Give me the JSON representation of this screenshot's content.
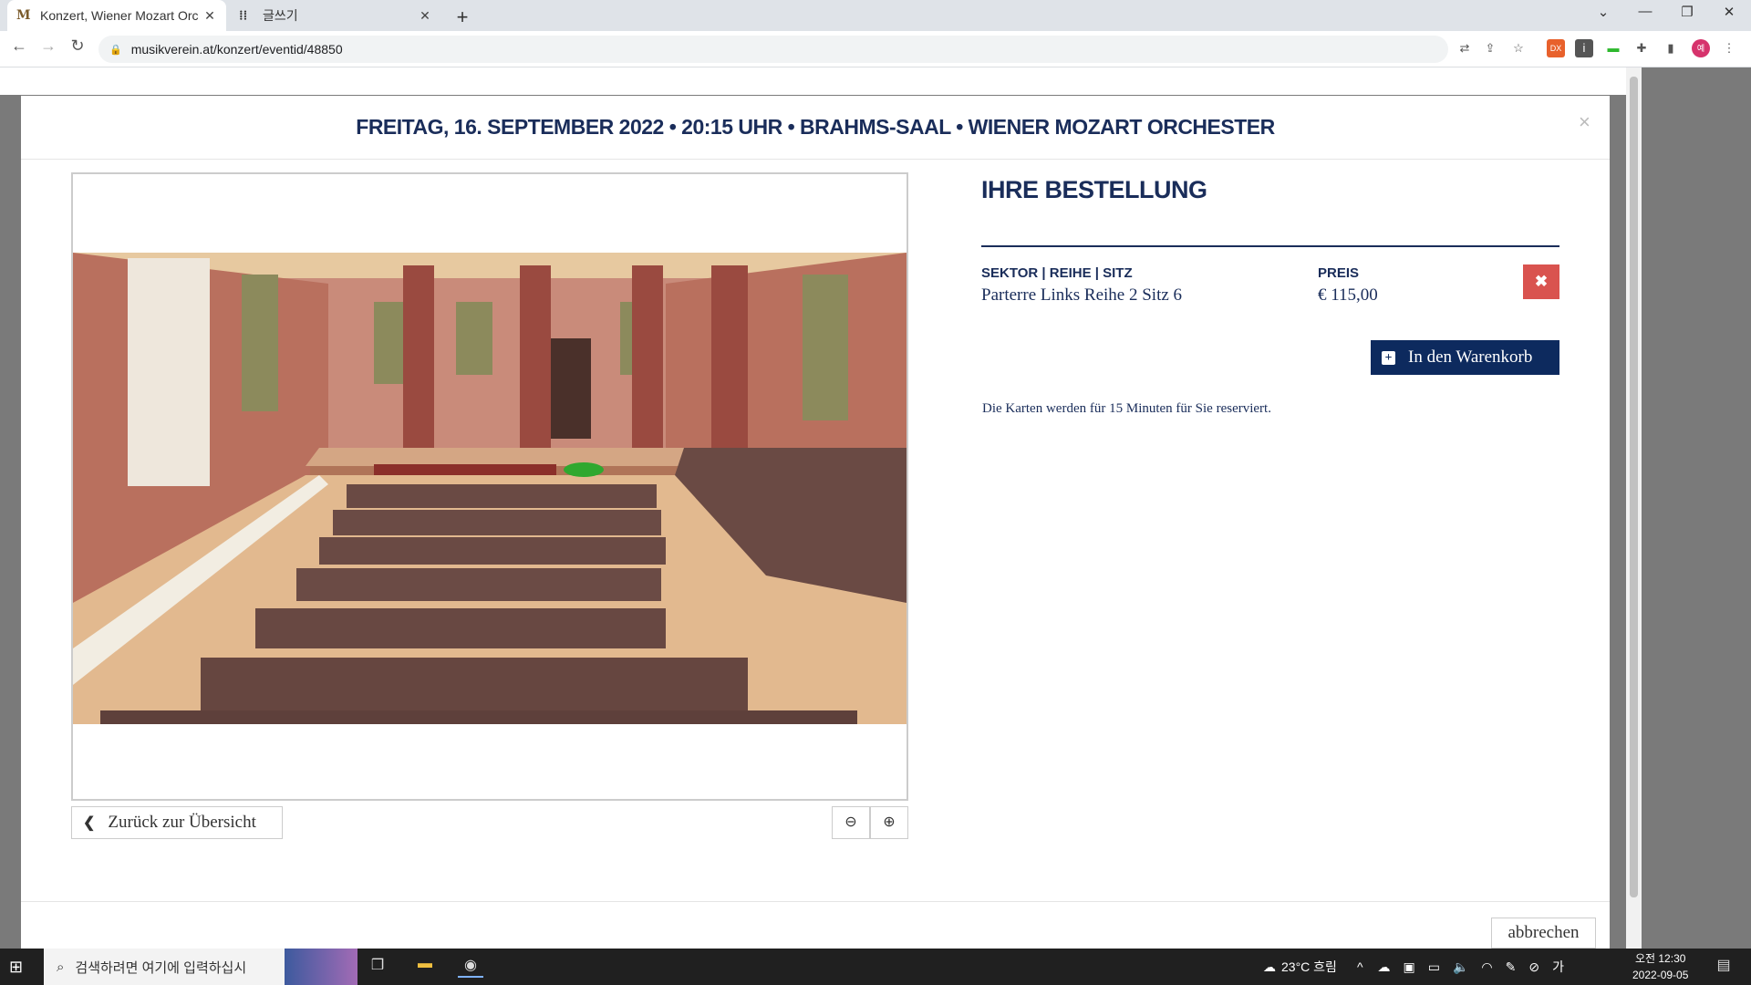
{
  "browser": {
    "tabs": [
      {
        "icon": "M",
        "title": "Konzert, Wiener Mozart Orc"
      },
      {
        "icon": "⁞⁞",
        "title": "글쓰기"
      }
    ],
    "url": "musikverein.at/konzert/eventid/48850"
  },
  "modal": {
    "title": "FREITAG, 16. SEPTEMBER 2022 • 20:15 UHR • BRAHMS-SAAL • WIENER MOZART ORCHESTER",
    "close_symbol": "×",
    "back_label": "Zurück zur Übersicht",
    "order": {
      "heading": "IHRE BESTELLUNG",
      "seat_header": "SEKTOR | REIHE | SITZ",
      "seat_value": "Parterre Links Reihe 2 Sitz 6",
      "price_header": "PREIS",
      "price_value": "€ 115,00",
      "cart_button": "In den Warenkorb",
      "reservation_note": "Die Karten werden für 15 Minuten für Sie reserviert."
    },
    "cancel_label": "abbrechen"
  },
  "taskbar": {
    "search_placeholder": "검색하려면 여기에 입력하십시",
    "weather": "23°C 흐림",
    "time": "오전 12:30",
    "date": "2022-09-05"
  },
  "colors": {
    "navy": "#1a2d5a",
    "button_navy": "#0d2a5e",
    "delete_red": "#d9534f"
  }
}
